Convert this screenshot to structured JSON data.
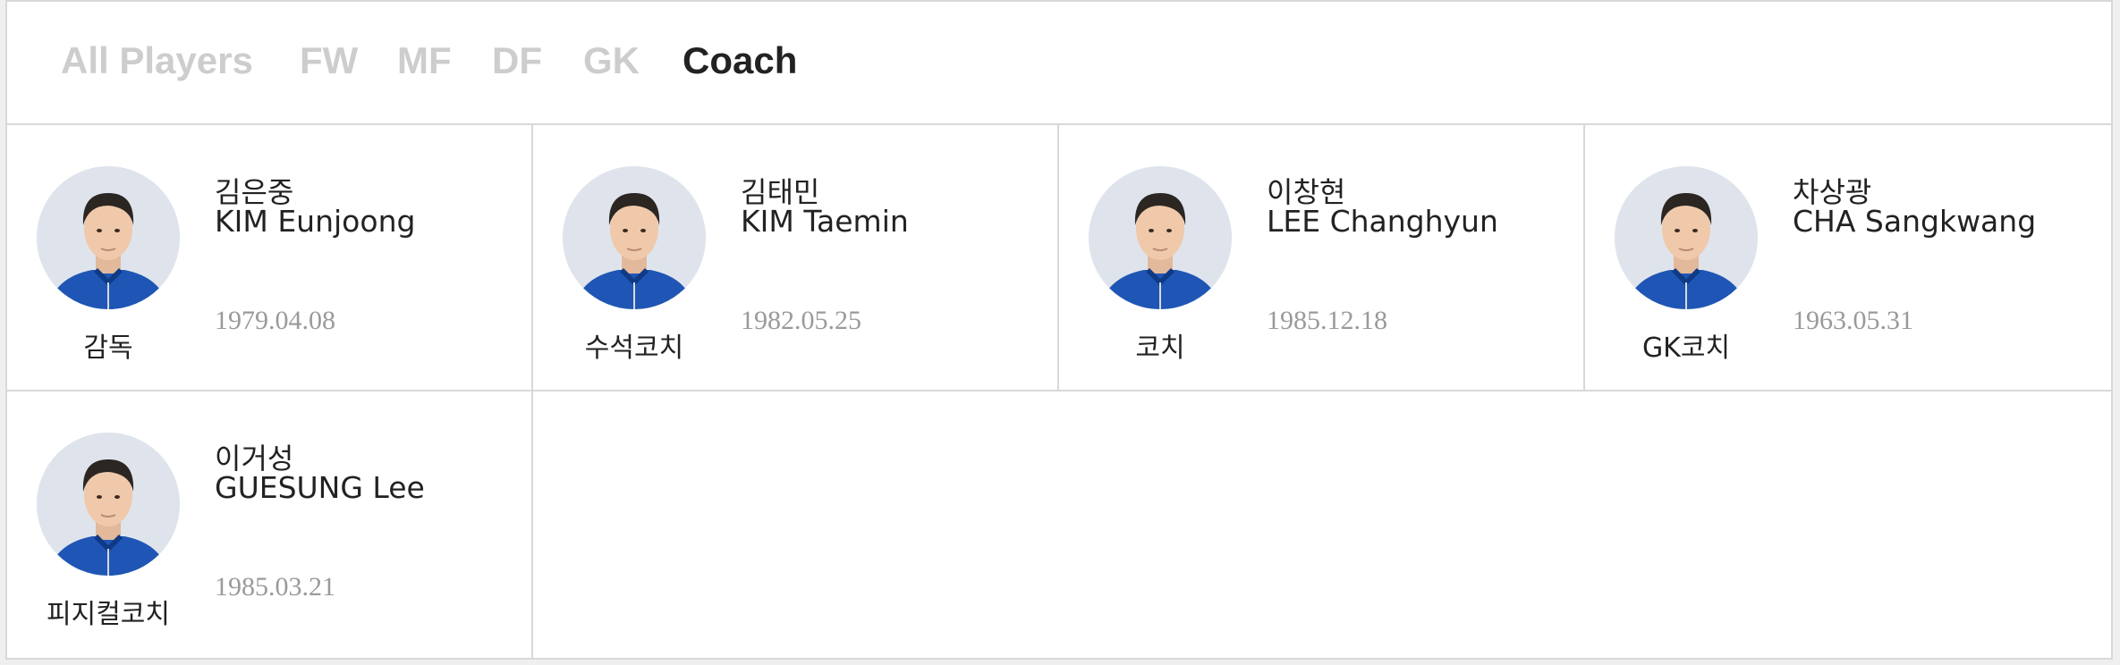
{
  "tabs": [
    {
      "label": "All Players",
      "active": false
    },
    {
      "label": "FW",
      "active": false
    },
    {
      "label": "MF",
      "active": false
    },
    {
      "label": "DF",
      "active": false
    },
    {
      "label": "GK",
      "active": false
    },
    {
      "label": "Coach",
      "active": true
    }
  ],
  "colors": {
    "tab_active": "#222222",
    "tab_inactive": "#cdcdcd",
    "jersey": "#1f56b5",
    "avatar_bg": "#dfe4ec",
    "date": "#9a9a9a",
    "border": "#d8d8d8"
  },
  "coaches": [
    {
      "name_ko": "김은중",
      "name_en": "KIM Eunjoong",
      "birth": "1979.04.08",
      "role": "감독"
    },
    {
      "name_ko": "김태민",
      "name_en": "KIM Taemin",
      "birth": "1982.05.25",
      "role": "수석코치"
    },
    {
      "name_ko": "이창현",
      "name_en": "LEE Changhyun",
      "birth": "1985.12.18",
      "role": "코치"
    },
    {
      "name_ko": "차상광",
      "name_en": "CHA Sangkwang",
      "birth": "1963.05.31",
      "role": "GK코치"
    },
    {
      "name_ko": "이거성",
      "name_en": "GUESUNG Lee",
      "birth": "1985.03.21",
      "role": "피지컬코치"
    }
  ]
}
